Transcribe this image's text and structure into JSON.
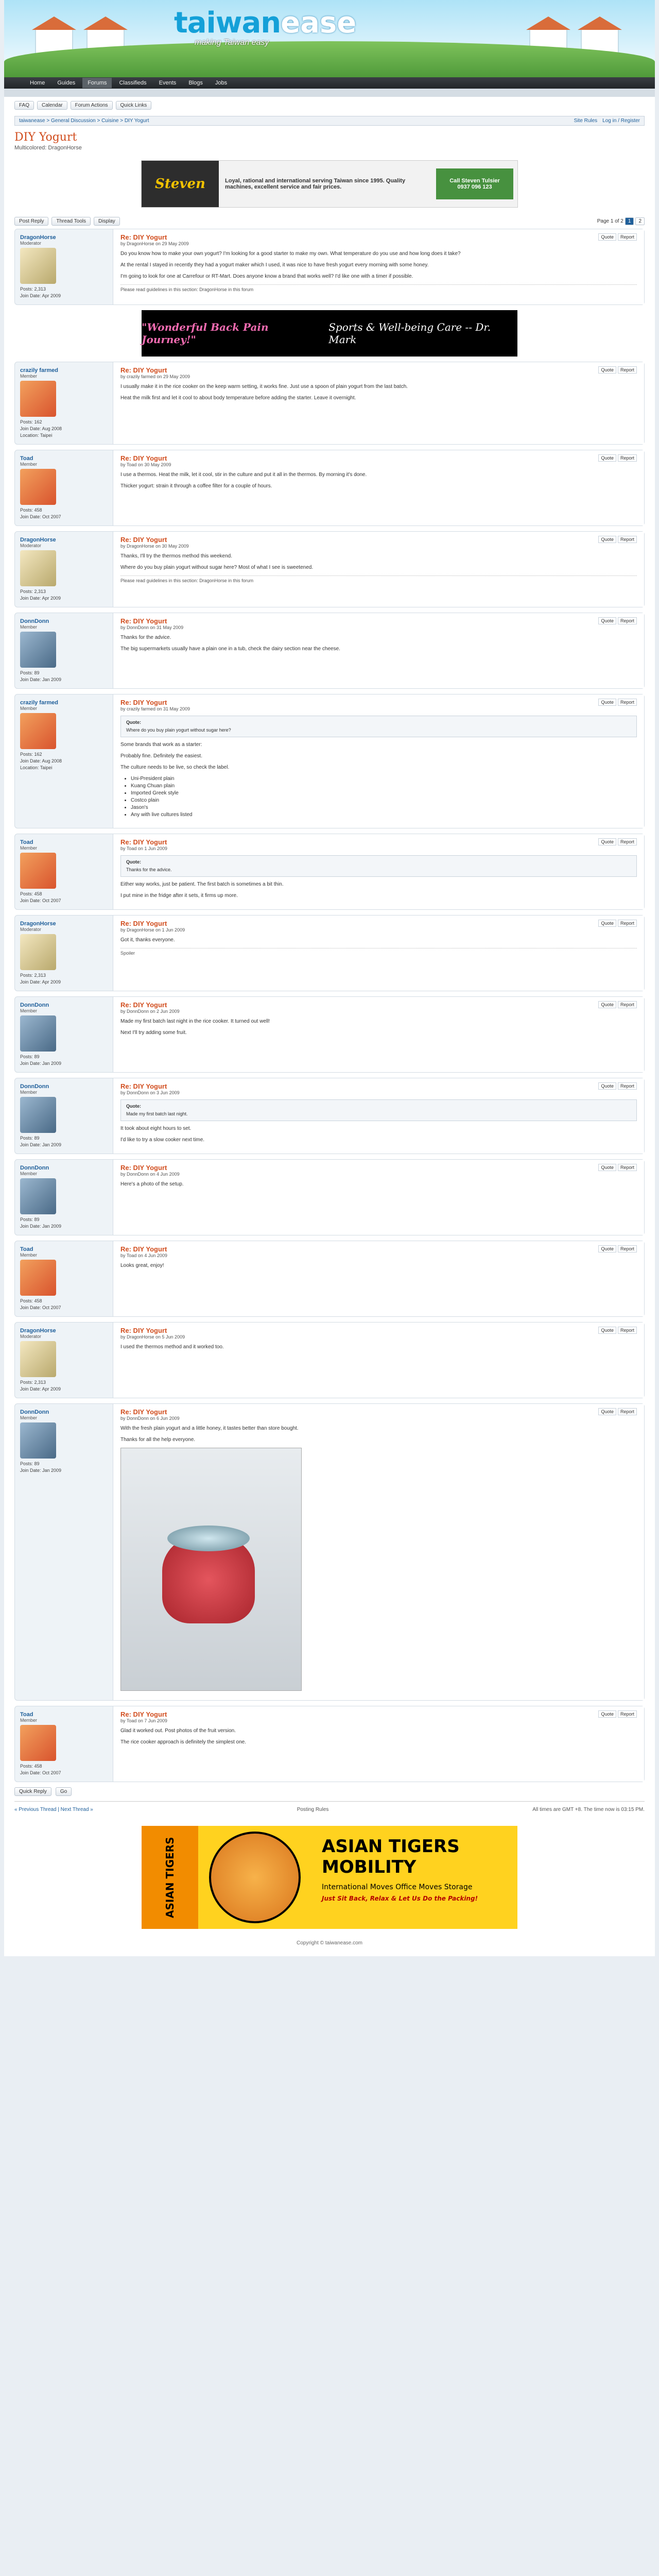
{
  "site": {
    "logo": {
      "part1": "taiwan",
      "part2": "ease",
      "tagline": "making Taiwan easy"
    },
    "nav": [
      "Home",
      "Guides",
      "Forums",
      "Classifieds",
      "Events",
      "Blogs",
      "Jobs"
    ],
    "active_nav": "Forums"
  },
  "crumbs": {
    "buttons": [
      "FAQ",
      "Calendar",
      "Forum Actions",
      "Quick Links"
    ],
    "path": "taiwanease > General Discussion > Cuisine > DIY Yogurt",
    "right": "Site Rules",
    "login": "Log in / Register"
  },
  "thread": {
    "title": "DIY Yogurt",
    "subtitle": "Multicolored: DragonHorse",
    "toolbar": {
      "reply": "Post Reply",
      "thread_tools": "Thread Tools",
      "display": "Display"
    },
    "pages": [
      "1",
      "2"
    ],
    "page_label": "Page 1 of 2"
  },
  "banner": {
    "left": "Steven",
    "middle": "Loyal, rational and international serving Taiwan since 1995. Quality machines, excellent service and fair prices.",
    "right_top": "Call Steven Tulsier",
    "right_bottom": "0937 096 123"
  },
  "ad2": {
    "left": "\"Wonderful Back Pain Journey!\"",
    "right": "Sports & Well-being Care -- Dr. Mark"
  },
  "posts": [
    {
      "user": "DragonHorse",
      "role": "Moderator",
      "av": "av-b",
      "alt": false,
      "stats": [
        "Posts: 2,313",
        "Join Date: Apr 2009"
      ],
      "title": "Re: DIY Yogurt",
      "by": "by DragonHorse on 29 May 2009",
      "paras": [
        "Do you know how to make your own yogurt? I'm looking for a good starter to make my own. What temperature do you use and how long does it take?",
        "At the rental I stayed in recently they had a yogurt maker which I used, it was nice to have fresh yogurt every morning with some honey.",
        "I'm going to look for one at Carrefour or RT-Mart. Does anyone know a brand that works well? I'd like one with a timer if possible."
      ],
      "sig": "Please read guidelines in this section: DragonHorse in this forum"
    },
    {
      "user": "crazily farmed",
      "role": "Member",
      "av": "av-a",
      "alt": false,
      "stats": [
        "Posts: 162",
        "Join Date: Aug 2008",
        "Location: Taipei"
      ],
      "title": "Re: DIY Yogurt",
      "by": "by crazily farmed on 29 May 2009",
      "paras": [
        "I usually make it in the rice cooker on the keep warm setting, it works fine. Just use a spoon of plain yogurt from the last batch.",
        "Heat the milk first and let it cool to about body temperature before adding the starter. Leave it overnight."
      ],
      "sig": ""
    },
    {
      "user": "Toad",
      "role": "Member",
      "av": "av-a",
      "alt": false,
      "stats": [
        "Posts: 458",
        "Join Date: Oct 2007"
      ],
      "title": "Re: DIY Yogurt",
      "by": "by Toad on 30 May 2009",
      "paras": [
        "I use a thermos. Heat the milk, let it cool, stir in the culture and put it all in the thermos. By morning it's done.",
        "Thicker yogurt: strain it through a coffee filter for a couple of hours."
      ],
      "sig": ""
    },
    {
      "user": "DragonHorse",
      "role": "Moderator",
      "av": "av-b",
      "alt": false,
      "stats": [
        "Posts: 2,313",
        "Join Date: Apr 2009"
      ],
      "title": "Re: DIY Yogurt",
      "by": "by DragonHorse on 30 May 2009",
      "paras": [
        "Thanks, I'll try the thermos method this weekend.",
        "Where do you buy plain yogurt without sugar here? Most of what I see is sweetened."
      ],
      "sig": "Please read guidelines in this section: DragonHorse in this forum"
    },
    {
      "user": "DonnDonn",
      "role": "Member",
      "av": "av-c",
      "alt": false,
      "stats": [
        "Posts: 89",
        "Join Date: Jan 2009"
      ],
      "title": "Re: DIY Yogurt",
      "by": "by DonnDonn on 31 May 2009",
      "paras": [
        "Thanks for the advice.",
        "The big supermarkets usually have a plain one in a tub, check the dairy section near the cheese."
      ],
      "sig": ""
    },
    {
      "user": "crazily farmed",
      "role": "Member",
      "av": "av-a",
      "alt": false,
      "stats": [
        "Posts: 162",
        "Join Date: Aug 2008",
        "Location: Taipei"
      ],
      "title": "Re: DIY Yogurt",
      "by": "by crazily farmed on 31 May 2009",
      "quote": "Where do you buy plain yogurt without sugar here?",
      "paras": [
        "Some brands that work as a starter:",
        "Probably fine. Definitely the easiest.",
        "The culture needs to be live, so check the label."
      ],
      "list": [
        "Uni-President plain",
        "Kuang Chuan plain",
        "Imported Greek style",
        "Costco plain",
        "Jason's",
        "Any with live cultures listed"
      ],
      "sig": ""
    },
    {
      "user": "Toad",
      "role": "Member",
      "av": "av-a",
      "alt": false,
      "stats": [
        "Posts: 458",
        "Join Date: Oct 2007"
      ],
      "title": "Re: DIY Yogurt",
      "by": "by Toad on 1 Jun 2009",
      "quote": "Thanks for the advice.",
      "paras": [
        "Either way works, just be patient. The first batch is sometimes a bit thin.",
        "I put mine in the fridge after it sets, it firms up more."
      ],
      "sig": ""
    },
    {
      "user": "DragonHorse",
      "role": "Moderator",
      "av": "av-b",
      "alt": false,
      "stats": [
        "Posts: 2,313",
        "Join Date: Apr 2009"
      ],
      "title": "Re: DIY Yogurt",
      "by": "by DragonHorse on 1 Jun 2009",
      "paras": [
        "Got it, thanks everyone."
      ],
      "sig": "Spoiler"
    },
    {
      "user": "DonnDonn",
      "role": "Member",
      "av": "av-c",
      "alt": false,
      "stats": [
        "Posts: 89",
        "Join Date: Jan 2009"
      ],
      "title": "Re: DIY Yogurt",
      "by": "by DonnDonn on 2 Jun 2009",
      "paras": [
        "Made my first batch last night in the rice cooker. It turned out well!",
        "Next I'll try adding some fruit."
      ],
      "sig": ""
    },
    {
      "user": "DonnDonn",
      "role": "Member",
      "av": "av-c",
      "alt": false,
      "stats": [
        "Posts: 89",
        "Join Date: Jan 2009"
      ],
      "title": "Re: DIY Yogurt",
      "by": "by DonnDonn on 3 Jun 2009",
      "quote": "Made my first batch last night.",
      "paras": [
        "It took about eight hours to set.",
        "I'd like to try a slow cooker next time."
      ],
      "sig": ""
    },
    {
      "user": "DonnDonn",
      "role": "Member",
      "av": "av-c",
      "alt": false,
      "stats": [
        "Posts: 89",
        "Join Date: Jan 2009"
      ],
      "title": "Re: DIY Yogurt",
      "by": "by DonnDonn on 4 Jun 2009",
      "paras": [
        "Here's a photo of the setup."
      ],
      "sig": ""
    },
    {
      "user": "Toad",
      "role": "Member",
      "av": "av-a",
      "alt": false,
      "stats": [
        "Posts: 458",
        "Join Date: Oct 2007"
      ],
      "title": "Re: DIY Yogurt",
      "by": "by Toad on 4 Jun 2009",
      "paras": [
        "Looks great, enjoy!"
      ],
      "sig": ""
    },
    {
      "user": "DragonHorse",
      "role": "Moderator",
      "av": "av-b",
      "alt": false,
      "stats": [
        "Posts: 2,313",
        "Join Date: Apr 2009"
      ],
      "title": "Re: DIY Yogurt",
      "by": "by DragonHorse on 5 Jun 2009",
      "paras": [
        "I used the thermos method and it worked too."
      ],
      "sig": ""
    },
    {
      "user": "DonnDonn",
      "role": "Member",
      "av": "av-c",
      "alt": false,
      "stats": [
        "Posts: 89",
        "Join Date: Jan 2009"
      ],
      "title": "Re: DIY Yogurt",
      "by": "by DonnDonn on 6 Jun 2009",
      "paras": [
        "With the fresh plain yogurt and a little honey, it tastes better than store bought.",
        "Thanks for all the help everyone."
      ],
      "photo": true,
      "sig": ""
    },
    {
      "user": "Toad",
      "role": "Member",
      "av": "av-a",
      "alt": false,
      "stats": [
        "Posts: 458",
        "Join Date: Oct 2007"
      ],
      "title": "Re: DIY Yogurt",
      "by": "by Toad on 7 Jun 2009",
      "paras": [
        "Glad it worked out. Post photos of the fruit version.",
        "The rice cooker approach is definitely the simplest one."
      ],
      "sig": ""
    }
  ],
  "quick_reply": {
    "label": "Quick Reply",
    "go": "Go"
  },
  "footer": {
    "left": "« Previous Thread | Next Thread »",
    "middle": "Posting Rules",
    "right": "All times are GMT +8. The time now is 03:15 PM."
  },
  "footad": {
    "left": "ASIAN TIGERS",
    "title": "ASIAN TIGERS MOBILITY",
    "services": "International Moves Office Moves Storage",
    "tagline": "Just Sit Back, Relax & Let Us Do the Packing!"
  },
  "copyright": "Copyright © taiwanease.com"
}
